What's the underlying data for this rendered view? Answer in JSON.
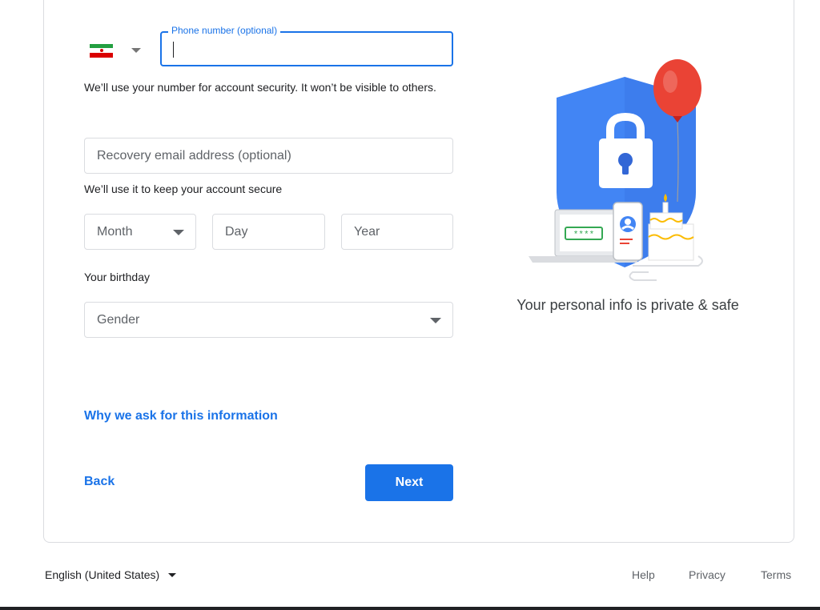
{
  "phone": {
    "label": "Phone number (optional)",
    "value": "",
    "country_flag": "iran-flag-icon",
    "helper": "We’ll use your number for account security. It won’t be visible to others."
  },
  "recovery_email": {
    "placeholder": "Recovery email address (optional)",
    "helper": "We’ll use it to keep your account secure"
  },
  "birthday": {
    "month_label": "Month",
    "day_placeholder": "Day",
    "year_placeholder": "Year",
    "helper": "Your birthday"
  },
  "gender": {
    "label": "Gender"
  },
  "links": {
    "why_ask": "Why we ask for this information"
  },
  "buttons": {
    "back": "Back",
    "next": "Next"
  },
  "illustration": {
    "caption": "Your personal info is private & safe",
    "password_mask": "****",
    "colors": {
      "shield": "#4285f4",
      "balloon": "#ea4335",
      "accent": "#fbbc04",
      "green": "#34a853"
    }
  },
  "footer": {
    "language": "English (United States)",
    "help": "Help",
    "privacy": "Privacy",
    "terms": "Terms"
  },
  "colors": {
    "accent": "#1a73e8",
    "border": "#dadce0",
    "text": "#202124",
    "muted": "#5f6368"
  }
}
